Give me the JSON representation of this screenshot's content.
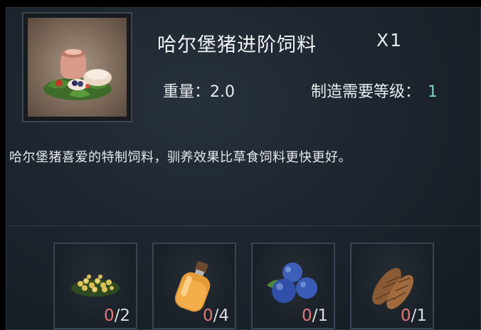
{
  "item": {
    "name": "哈尔堡猪进阶饲料",
    "quantity": "X1",
    "icon": "feed-bowl-icon"
  },
  "stats": {
    "weight_label": "重量：",
    "weight_value": "2.0",
    "req_label": "制造需要等级：",
    "req_value": "1"
  },
  "description": "哈尔堡猪喜爱的特制饲料，驯养效果比草食饲料更快更好。",
  "materials": [
    {
      "icon": "yellow-flower-icon",
      "have": "0",
      "sep": "/",
      "need": "2"
    },
    {
      "icon": "honey-bottle-icon",
      "have": "0",
      "sep": "/",
      "need": "4"
    },
    {
      "icon": "blueberry-icon",
      "have": "0",
      "sep": "/",
      "need": "1"
    },
    {
      "icon": "pine-cone-icon",
      "have": "0",
      "sep": "/",
      "need": "1"
    }
  ],
  "colors": {
    "text": "#e8ebee",
    "level": "#7fd0c4",
    "have_count": "#e0787a"
  }
}
